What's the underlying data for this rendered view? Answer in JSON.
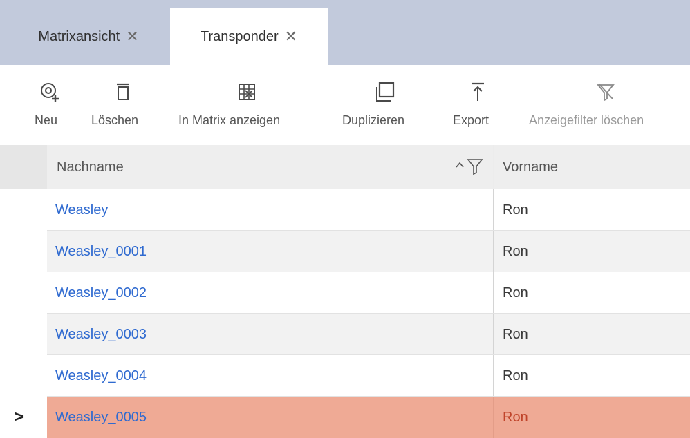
{
  "tabs": [
    {
      "label": "Matrixansicht",
      "close": "✕"
    },
    {
      "label": "Transponder",
      "close": "✕"
    }
  ],
  "toolbar": {
    "new_label": "Neu",
    "delete_label": "Löschen",
    "show_in_matrix_label": "In Matrix anzeigen",
    "duplicate_label": "Duplizieren",
    "export_label": "Export",
    "clear_filter_label": "Anzeigefilter löschen"
  },
  "table": {
    "columns": [
      "Nachname",
      "Vorname"
    ],
    "sort_indicator": "^",
    "rows": [
      {
        "nachname": "Weasley",
        "vorname": "Ron"
      },
      {
        "nachname": "Weasley_0001",
        "vorname": "Ron"
      },
      {
        "nachname": "Weasley_0002",
        "vorname": "Ron"
      },
      {
        "nachname": "Weasley_0003",
        "vorname": "Ron"
      },
      {
        "nachname": "Weasley_0004",
        "vorname": "Ron"
      },
      {
        "nachname": "Weasley_0005",
        "vorname": "Ron"
      }
    ],
    "selected_marker": ">"
  },
  "colors": {
    "tabbar": "#c2cadc",
    "link": "#2f6ad0",
    "selected_row": "#efaa95",
    "selected_text": "#c0442a"
  }
}
